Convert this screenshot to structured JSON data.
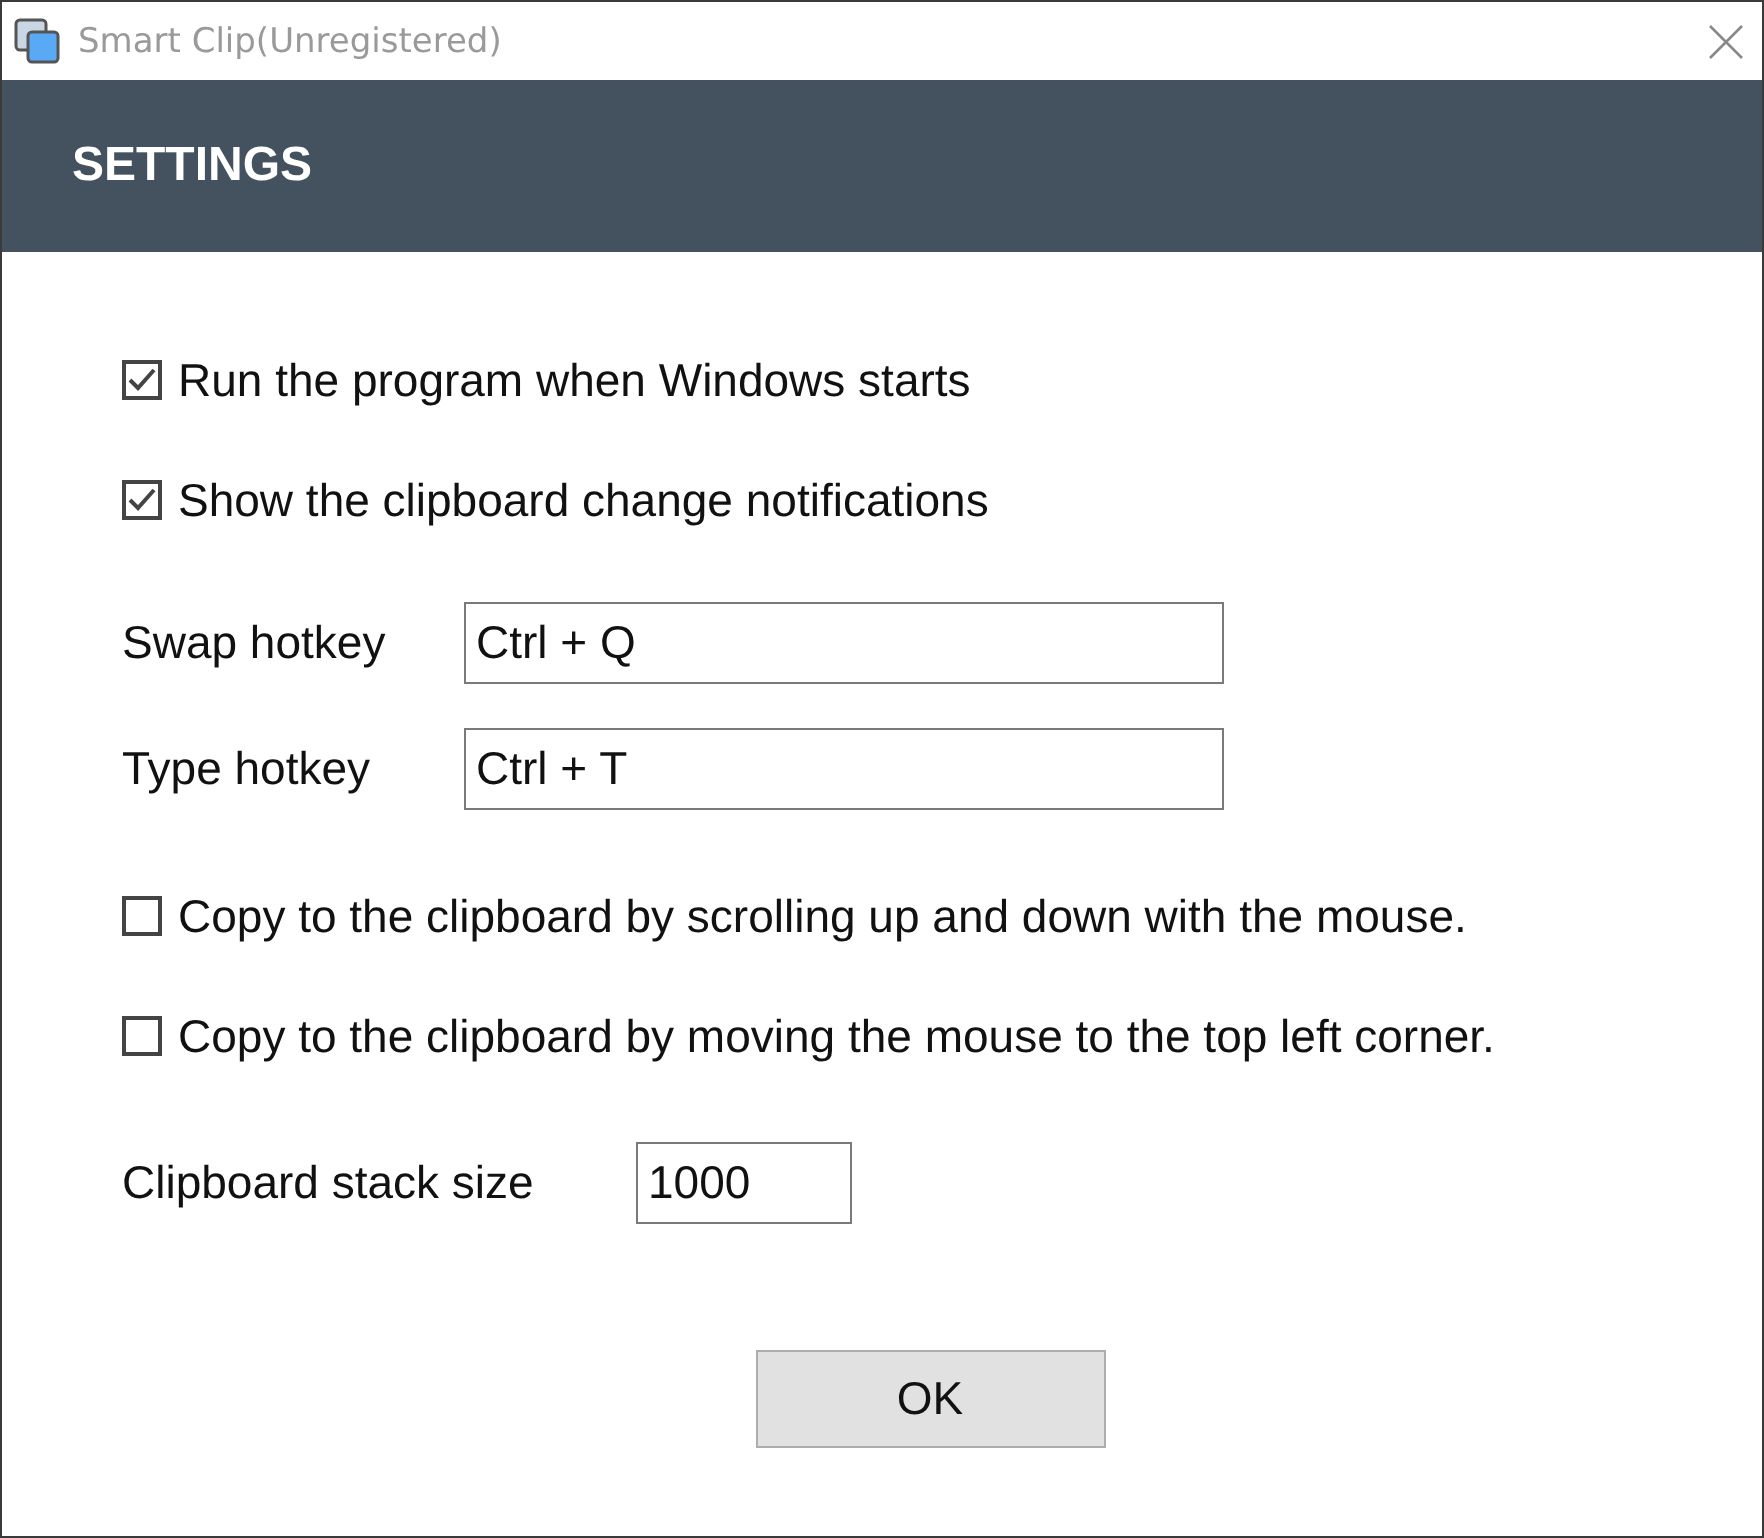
{
  "window": {
    "title": "Smart Clip(Unregistered)"
  },
  "header": {
    "title": "SETTINGS"
  },
  "options": [
    {
      "kind": "checkbox",
      "label": "Run the program when Windows starts",
      "checked": true
    },
    {
      "kind": "checkbox",
      "label": "Show the clipboard change notifications",
      "checked": true
    },
    {
      "kind": "field",
      "label": "Swap hotkey",
      "value": "Ctrl + Q"
    },
    {
      "kind": "field",
      "label": "Type hotkey",
      "value": "Ctrl + T"
    },
    {
      "kind": "checkbox",
      "label": "Copy to the clipboard by scrolling up and down with the mouse.",
      "checked": false
    },
    {
      "kind": "checkbox",
      "label": "Copy to the clipboard by moving the mouse to the top left corner.",
      "checked": false
    },
    {
      "kind": "short-field",
      "label": "Clipboard stack size",
      "value": "1000"
    }
  ],
  "buttons": [
    "OK"
  ]
}
